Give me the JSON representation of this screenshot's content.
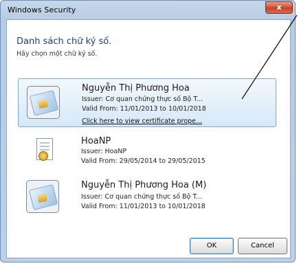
{
  "window": {
    "title": "Windows Security",
    "close_label": "x"
  },
  "dialog": {
    "heading": "Danh sách chữ ký số.",
    "subheading": "Hãy chọn một chữ ký số."
  },
  "certificates": [
    {
      "name": "Nguyễn Thị Phương Hoa",
      "issuer": "Issuer: Cơ quan chứng thực số Bộ T...",
      "valid": "Valid From: 11/01/2013 to 10/01/2018",
      "link": "Click here to view certificate prope...",
      "selected": true,
      "icon": "smart-card-icon"
    },
    {
      "name": "HoaNP",
      "issuer": "Issuer: HoaNP",
      "valid": "Valid From: 29/05/2014 to 29/05/2015",
      "selected": false,
      "icon": "certificate-document-icon"
    },
    {
      "name": "Nguyễn Thị Phương Hoa (M)",
      "issuer": "Issuer: Cơ quan chứng thực số Bộ T...",
      "valid": "Valid From: 11/01/2013 to 10/01/2018",
      "selected": false,
      "icon": "smart-card-icon"
    }
  ],
  "buttons": {
    "ok": "OK",
    "cancel": "Cancel"
  },
  "colors": {
    "heading": "#1e3e8a",
    "selection_border": "#7ea7d5",
    "close_button": "#c4452a"
  }
}
